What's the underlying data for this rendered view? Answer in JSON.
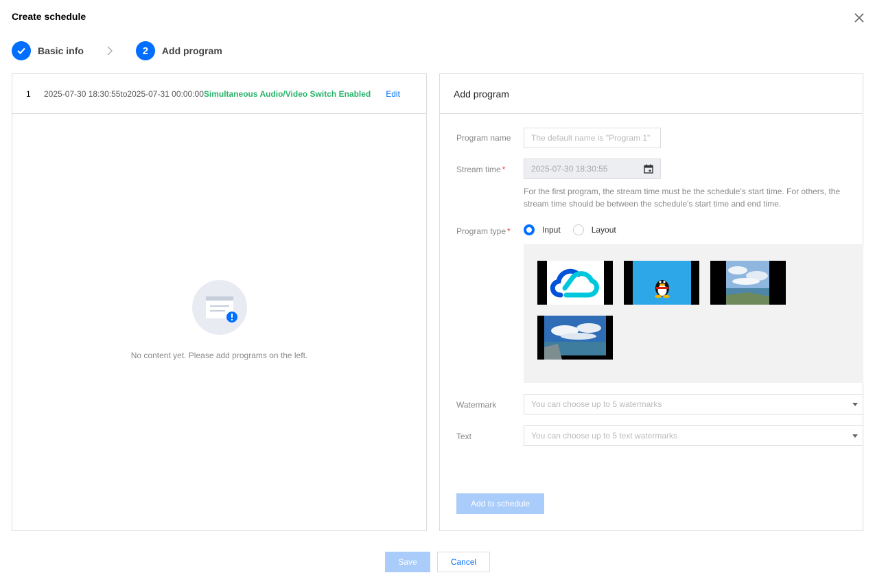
{
  "dialog": {
    "title": "Create schedule"
  },
  "icons": {
    "close": "close-icon",
    "check": "check-icon",
    "chevron": "chevron-right-icon",
    "calendar": "calendar-icon",
    "empty": "empty-document-icon",
    "caret": "caret-down-icon"
  },
  "steps": [
    {
      "label": "Basic info",
      "status": "done"
    },
    {
      "number": "2",
      "label": "Add program",
      "status": "active"
    }
  ],
  "schedule": {
    "index": "1",
    "time_range": "2025-07-30 18:30:55to2025-07-31 00:00:00",
    "status": "Simultaneous Audio/Video Switch Enabled",
    "edit_label": "Edit"
  },
  "empty_state": {
    "text": "No content yet. Please add programs on the left."
  },
  "add_program": {
    "header": "Add program",
    "program_name": {
      "label": "Program name",
      "placeholder": "The default name is \"Program 1\""
    },
    "stream_time": {
      "label": "Stream time",
      "required": "*",
      "value": "2025-07-30 18:30:55",
      "help": "For the first program, the stream time must be the schedule's start time. For others, the stream time should be between the schedule's start time and end time."
    },
    "program_type": {
      "label": "Program type",
      "required": "*",
      "options": [
        "Input",
        "Layout"
      ],
      "selected": "Input"
    },
    "watermark": {
      "label": "Watermark",
      "placeholder": "You can choose up to 5 watermarks"
    },
    "text": {
      "label": "Text",
      "placeholder": "You can choose up to 5 text watermarks"
    },
    "submit_label": "Add to schedule"
  },
  "footer": {
    "save_label": "Save",
    "cancel_label": "Cancel"
  },
  "colors": {
    "primary": "#006eff",
    "primary_disabled": "#a9ccfb",
    "success": "#29b36a",
    "required": "#e54545"
  }
}
